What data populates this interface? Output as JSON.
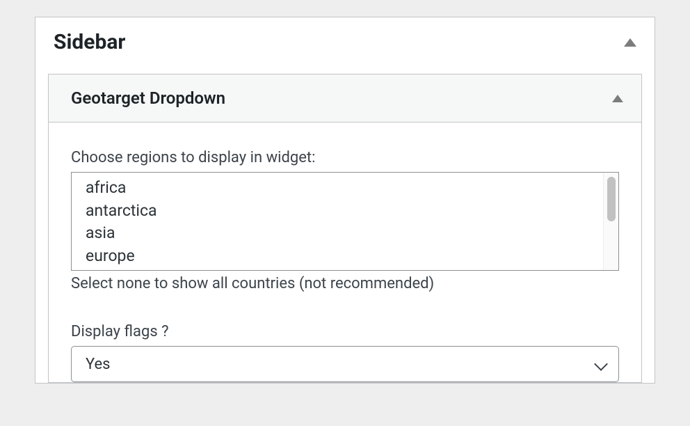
{
  "panel": {
    "title": "Sidebar"
  },
  "widget": {
    "title": "Geotarget Dropdown",
    "regions": {
      "label": "Choose regions to display in widget:",
      "options": [
        "africa",
        "antarctica",
        "asia",
        "europe"
      ],
      "help": "Select none to show all countries (not recommended)"
    },
    "flags": {
      "label": "Display flags ?",
      "value": "Yes"
    }
  }
}
